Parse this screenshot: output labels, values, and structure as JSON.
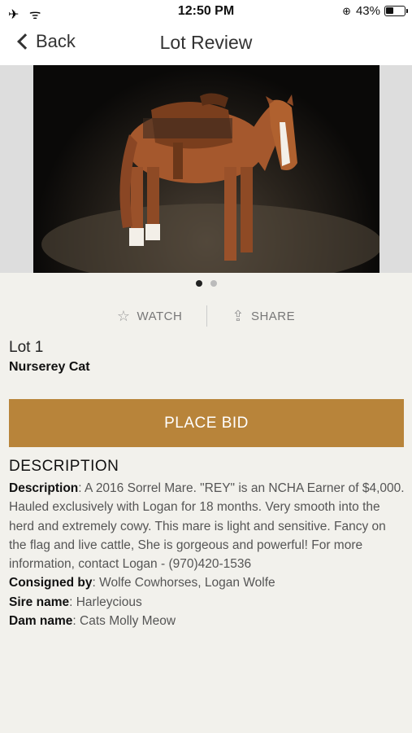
{
  "status_bar": {
    "left_icons": "✈ ᯤ",
    "time": "12:50 PM",
    "battery_percent": "43%",
    "battery_level": 0.43
  },
  "nav": {
    "back_label": "Back",
    "title": "Lot Review"
  },
  "carousel": {
    "image_alt": "Sorrel mare with western saddle",
    "page_count": 2,
    "active_index": 0
  },
  "actions": {
    "watch_label": "WATCH",
    "share_label": "SHARE"
  },
  "lot": {
    "number": "Lot 1",
    "name": "Nurserey Cat"
  },
  "bid_button_label": "PLACE BID",
  "description": {
    "heading": "DESCRIPTION",
    "description_label": "Description",
    "description_text": ": A 2016 Sorrel Mare. \"REY\" is an NCHA Earner of $4,000. Hauled exclusively with Logan for 18 months. Very smooth into the herd and extremely cowy. This mare is light and sensitive. Fancy on the flag and live cattle, She is gorgeous and powerful! For more information, contact Logan - (970)420-1536",
    "consigned_label": "Consigned by",
    "consigned_value": ": Wolfe Cowhorses, Logan Wolfe",
    "sire_label": "Sire name",
    "sire_value": ": Harleycious",
    "dam_label": "Dam name",
    "dam_value": ": Cats Molly Meow"
  },
  "colors": {
    "accent": "#b8843a",
    "background": "#f2f1ec"
  }
}
